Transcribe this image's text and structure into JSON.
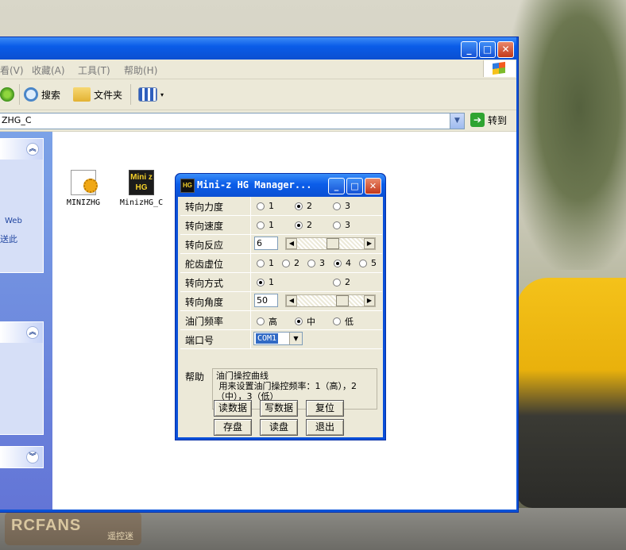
{
  "watermark": {
    "logo": "RCFANS",
    "sub": "遥控迷"
  },
  "explorer": {
    "menu": [
      "看(V)",
      "收藏(A)",
      "工具(T)",
      "帮助(H)"
    ],
    "toolbar": {
      "search": "搜索",
      "folders": "文件夹"
    },
    "address": {
      "value": "ZHG_C",
      "go": "转到"
    },
    "left_panel": {
      "text1": "Web",
      "text2": "送此"
    },
    "files": [
      {
        "name": "MINIZHG",
        "icon": "config-file-icon"
      },
      {
        "name": "MinizHG_C",
        "icon": "miniz-hg-app-icon",
        "icon_text": "Mini z HG"
      }
    ]
  },
  "dialog": {
    "title": "Mini-z HG Manager...",
    "icon_text": "HG",
    "rows": [
      {
        "label": "转向力度",
        "options": [
          "1",
          "2",
          "3"
        ],
        "selected": 1
      },
      {
        "label": "转向速度",
        "options": [
          "1",
          "2",
          "3"
        ],
        "selected": 1
      },
      {
        "label": "转向反应",
        "value": "6",
        "slider_fraction": 0.55
      },
      {
        "label": "舵齿虚位",
        "options": [
          "1",
          "2",
          "3",
          "4",
          "5"
        ],
        "selected": 3
      },
      {
        "label": "转向方式",
        "options": [
          "1",
          "2"
        ],
        "selected": 0
      },
      {
        "label": "转向角度",
        "value": "50",
        "slider_fraction": 0.72
      },
      {
        "label": "油门频率",
        "options": [
          "高",
          "中",
          "低"
        ],
        "selected": 1
      },
      {
        "label": "端口号",
        "combo": "COM1"
      }
    ],
    "help": {
      "label": "帮助",
      "text": "油门操控曲线\n 用来设置油门操控频率：1（高），2（中），3（低）\n          ."
    },
    "buttons_row1": [
      "读数据",
      "写数据",
      "复位"
    ],
    "buttons_row2": [
      "存盘",
      "读盘",
      "退出"
    ]
  }
}
